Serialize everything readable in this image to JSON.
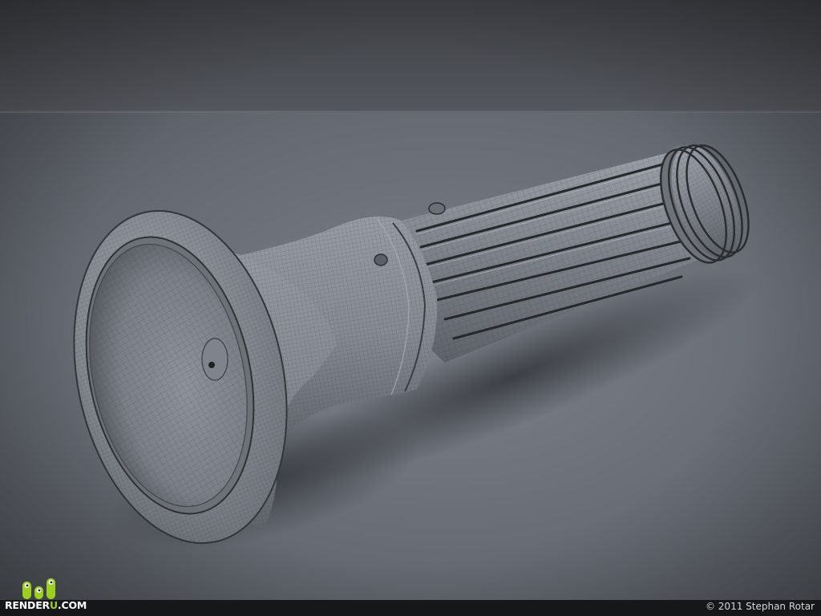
{
  "watermark": {
    "brand_prefix": "RENDER",
    "brand_accent": "U",
    "brand_suffix": ".COM",
    "accent_color": "#9bd020"
  },
  "credit": {
    "copyright": "© 2011 Stephan Rotar"
  },
  "colors": {
    "wall": "#4a4d53",
    "floor": "#6a6f77",
    "model_clay": "#7d8289",
    "wire": "#3c3f44"
  }
}
